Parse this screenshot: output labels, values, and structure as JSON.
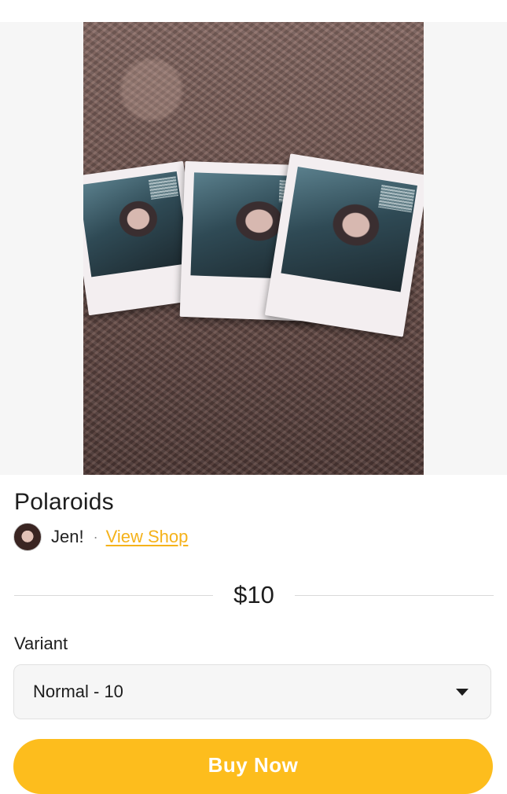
{
  "product": {
    "image_alt": "three polaroid photos on carpet",
    "title": "Polaroids",
    "price": "$10"
  },
  "seller": {
    "name": "Jen!",
    "separator": "·",
    "view_shop_label": "View Shop"
  },
  "variant": {
    "label": "Variant",
    "selected": "Normal - 10"
  },
  "actions": {
    "buy_label": "Buy Now"
  },
  "colors": {
    "accent": "#fdbd1d",
    "link": "#f5b21a",
    "text": "#1d1d1d",
    "divider": "#d9d9d9",
    "select_bg": "#f6f6f6"
  },
  "icons": {
    "variant_dropdown": "caret-down-icon"
  }
}
